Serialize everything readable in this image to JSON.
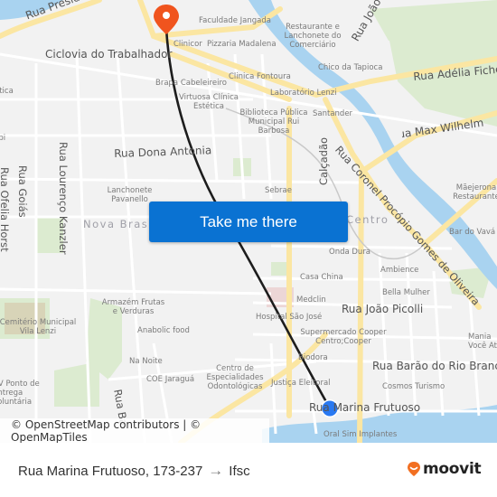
{
  "map": {
    "action_button": "Take me there",
    "attribution": "© OpenStreetMap contributors | © OpenMapTiles",
    "roads": [
      {
        "name": "Rua Presidente",
        "id": "rua-presidente"
      },
      {
        "name": "Ciclovia do Trabalhador",
        "id": "ciclovia"
      },
      {
        "name": "Rua João L",
        "id": "rua-joao-l"
      },
      {
        "name": "Rua Adélia Fiche",
        "id": "rua-adelia"
      },
      {
        "name": "Rua Max Wilhelm",
        "id": "rua-max"
      },
      {
        "name": "Rua Dona Antonia",
        "id": "rua-dona-antonia"
      },
      {
        "name": "Rua Coronel Procópio Gomes de Oliveira",
        "id": "rua-coronel"
      },
      {
        "name": "Calçadão",
        "id": "calcadao"
      },
      {
        "name": "Rua Lourenço Kanzler",
        "id": "rua-lourenco"
      },
      {
        "name": "Rua Goiás",
        "id": "rua-goias"
      },
      {
        "name": "Rua Ofelia Horst",
        "id": "rua-ofelia"
      },
      {
        "name": "Rua João Picolli",
        "id": "rua-joao-picolli"
      },
      {
        "name": "Rua Barão do Rio Branco",
        "id": "rua-barao"
      },
      {
        "name": "Rua Marina Frutuoso",
        "id": "rua-marina"
      },
      {
        "name": "Rua Ba",
        "id": "rua-ba"
      }
    ],
    "areas": [
      {
        "name": "Nova Brasília",
        "id": "nova-brasilia"
      },
      {
        "name": "Centro",
        "id": "centro"
      }
    ],
    "pois": [
      "Faculdade Jangada",
      "Restaurante e Lanchonete do Comerciário",
      "Clinicor",
      "Pizzaria Madalena",
      "Chico da Tapioca",
      "Clinica Fontoura",
      "Brapa Cabeleireiro",
      "Laboratório Lenzi",
      "Virtuosa Clínica Estética",
      "Biblioteca Pública Municipal Rui Barbosa",
      "Santander",
      "Lanchonete Pavanello",
      "Sebrae",
      "Mãejerona Restaurante",
      "Bar do Vavá",
      "Onda Dura",
      "Ambience",
      "Casa China",
      "Bella Mulher",
      "Medclin",
      "Hospital São José",
      "Supermercado Cooper Centro;Cooper",
      "Mania Você At",
      "Armazém Frutas e Verduras",
      "Cemitério Municipal Vila Lenzi",
      "Anabolic food",
      "Biodora",
      "Na Noite",
      "COE Jaraguá",
      "Centro de Especialidades Odontológicas",
      "Justiça Eleitoral",
      "Cosmos Turismo",
      "CV Ponto de Entrega Voluntária",
      "Oral Sim Implantes",
      "ética",
      "ibi"
    ],
    "origin_marker": {
      "label": "Rua Marina Frutuoso, 173-237",
      "color": "#2979f2"
    },
    "destination_marker": {
      "label": "Ifsc",
      "color": "#f0541e"
    },
    "route_color": "#1d1d1d"
  },
  "footer": {
    "origin": "Rua Marina Frutuoso, 173-237",
    "arrow": "→",
    "destination": "Ifsc",
    "brand": "moovit",
    "brand_color": "#f26f21"
  }
}
